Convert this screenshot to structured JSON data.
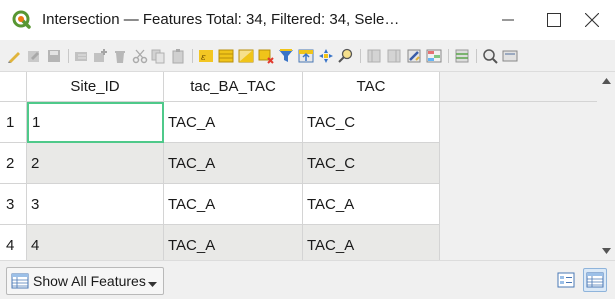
{
  "window": {
    "title": "Intersection — Features Total: 34, Filtered: 34, Sele…",
    "app_icon": "qgis-icon",
    "controls": [
      "minimize-icon",
      "maximize-icon",
      "close-icon"
    ]
  },
  "toolbar": {
    "icons": [
      "toggle-editing-icon",
      "toggle-multi-edit-icon",
      "save-edits-icon",
      "reload-table-icon",
      "add-feature-icon",
      "delete-features-icon",
      "cut-icon",
      "copy-icon",
      "paste-icon",
      "expression-select-icon",
      "select-all-icon",
      "invert-selection-icon",
      "deselect-all-icon",
      "filter-select-icon",
      "move-selection-top-icon",
      "pan-to-selection-icon",
      "zoom-to-selection-icon",
      "new-field-icon",
      "delete-field-icon",
      "field-calculator-icon",
      "conditional-formatting-icon",
      "organize-columns-icon",
      "dock-icon",
      "actions-icon"
    ]
  },
  "table": {
    "columns": [
      "Site_ID",
      "tac_BA_TAC",
      "TAC"
    ],
    "rows": [
      {
        "num": "1",
        "cells": [
          "1",
          "TAC_A",
          "TAC_C"
        ]
      },
      {
        "num": "2",
        "cells": [
          "2",
          "TAC_A",
          "TAC_C"
        ]
      },
      {
        "num": "3",
        "cells": [
          "3",
          "TAC_A",
          "TAC_A"
        ]
      },
      {
        "num": "4",
        "cells": [
          "4",
          "TAC_A",
          "TAC_A"
        ]
      }
    ],
    "selected_cell": {
      "row": 0,
      "col": 0
    },
    "selection_color": "#4fc98a",
    "alt_row_color": "#e9e9e7"
  },
  "statusbar": {
    "filter_button_label": "Show All Features",
    "filter_icon": "table-icon",
    "form_view_icon": "form-view-icon",
    "table_view_icon": "table-view-icon",
    "active_view": "table"
  }
}
